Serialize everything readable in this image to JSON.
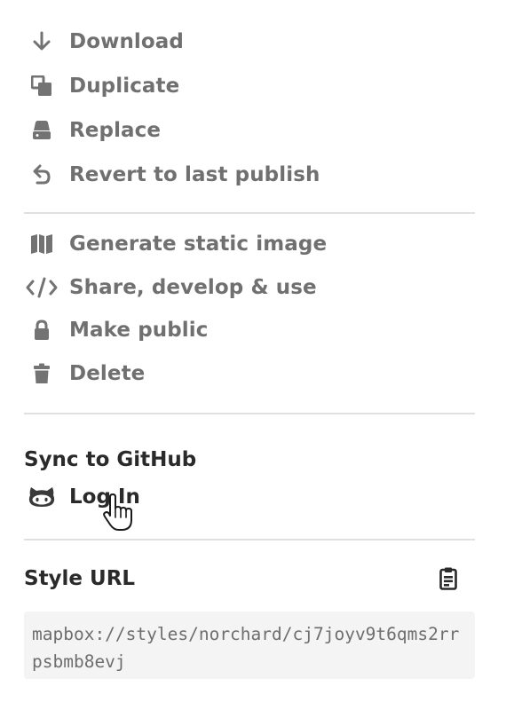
{
  "actions": [
    {
      "label": "Download",
      "icon": "download-icon"
    },
    {
      "label": "Duplicate",
      "icon": "duplicate-icon"
    },
    {
      "label": "Replace",
      "icon": "replace-icon"
    },
    {
      "label": "Revert to last publish",
      "icon": "revert-icon"
    }
  ],
  "more_actions": [
    {
      "label": "Generate static image",
      "icon": "map-icon"
    },
    {
      "label": "Share, develop & use",
      "icon": "code-icon"
    },
    {
      "label": "Make public",
      "icon": "lock-icon"
    },
    {
      "label": "Delete",
      "icon": "trash-icon"
    }
  ],
  "github": {
    "title": "Sync to GitHub",
    "login_label": "Log In",
    "icon": "github-octocat-icon"
  },
  "style_url": {
    "title": "Style URL",
    "value": "mapbox://styles/norchard/cj7joyv9t6qms2rrpsbmb8evj",
    "copy_icon": "clipboard-icon"
  },
  "colors": {
    "menu_text": "#707070",
    "heading_text": "#2a2a2a",
    "divider": "#e0e0e0",
    "url_background": "#f4f4f4"
  }
}
